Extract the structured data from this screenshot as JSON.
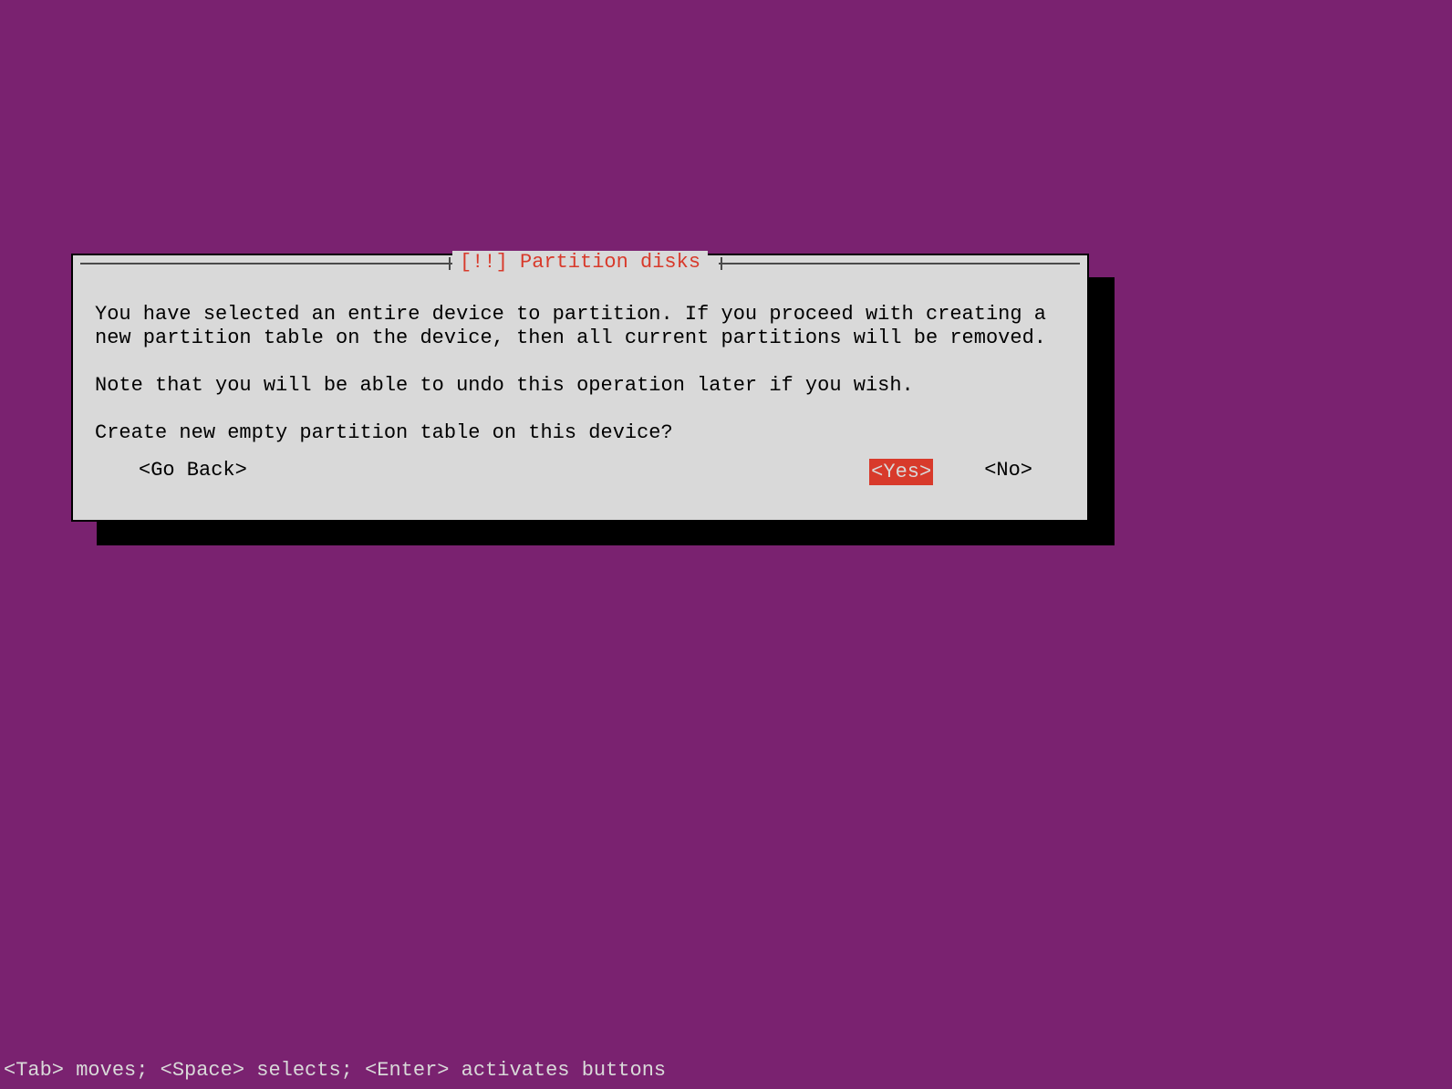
{
  "dialog": {
    "title": "[!!] Partition disks",
    "paragraph1": "You have selected an entire device to partition. If you proceed with creating a new partition table on the device, then all current partitions will be removed.",
    "paragraph2": "Note that you will be able to undo this operation later if you wish.",
    "paragraph3": "Create new empty partition table on this device?",
    "buttons": {
      "go_back": "<Go Back>",
      "yes": "<Yes>",
      "no": "<No>"
    }
  },
  "footer": {
    "text": "<Tab> moves; <Space> selects; <Enter> activates buttons"
  },
  "colors": {
    "background": "#7a2270",
    "dialog_bg": "#d9d9d9",
    "accent": "#d83a2b",
    "text": "#000000"
  }
}
